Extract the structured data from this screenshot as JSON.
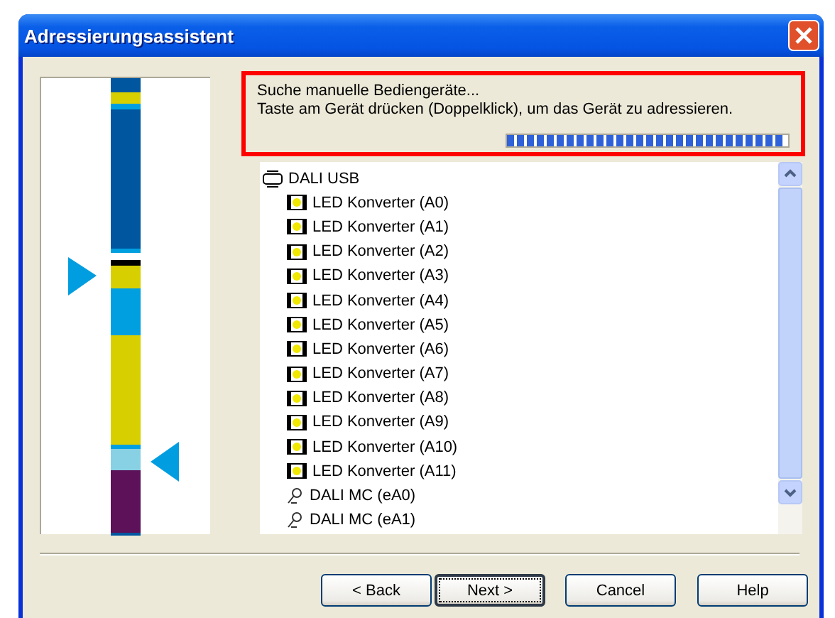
{
  "window": {
    "title": "Adressierungsassistent"
  },
  "status": {
    "lines": [
      "Suche manuelle Bediengeräte...",
      "Taste am Gerät drücken (Doppelklick), um das Gerät zu adressieren."
    ],
    "progress": {
      "level": 0.98
    }
  },
  "tree": [
    {
      "label": "DALI USB",
      "kind": "bus",
      "children": [
        {
          "label": "LED Konverter (A0)",
          "kind": "led"
        },
        {
          "label": "LED Konverter (A1)",
          "kind": "led"
        },
        {
          "label": "LED Konverter (A2)",
          "kind": "led"
        },
        {
          "label": "LED Konverter (A3)",
          "kind": "led"
        },
        {
          "label": "LED Konverter (A4)",
          "kind": "led"
        },
        {
          "label": "LED Konverter (A5)",
          "kind": "led"
        },
        {
          "label": "LED Konverter (A6)",
          "kind": "led"
        },
        {
          "label": "LED Konverter (A7)",
          "kind": "led"
        },
        {
          "label": "LED Konverter (A8)",
          "kind": "led"
        },
        {
          "label": "LED Konverter (A9)",
          "kind": "led"
        },
        {
          "label": "LED Konverter (A10)",
          "kind": "led"
        },
        {
          "label": "LED Konverter (A11)",
          "kind": "led"
        },
        {
          "label": "DALI MC (eA0)",
          "kind": "mc"
        },
        {
          "label": "DALI MC (eA1)",
          "kind": "mc"
        }
      ]
    }
  ],
  "buttons": [
    {
      "label": "< Back",
      "default": false
    },
    {
      "label": "Next >",
      "default": true
    },
    {
      "label": "Cancel",
      "default": false
    },
    {
      "label": "Help",
      "default": false
    }
  ]
}
